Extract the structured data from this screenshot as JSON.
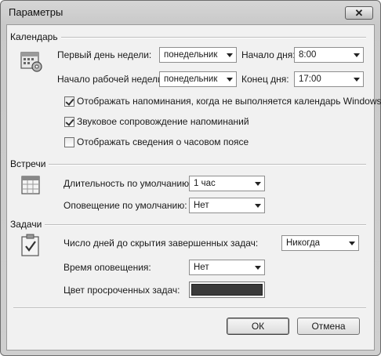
{
  "window": {
    "title": "Параметры",
    "close_icon": "close-icon"
  },
  "calendar": {
    "section_label": "Календарь",
    "first_day_label": "Первый день недели:",
    "first_day_value": "понедельник",
    "start_day_label": "Начало дня:",
    "start_day_value": "8:00",
    "workweek_start_label": "Начало рабочей недели:",
    "workweek_start_value": "понедельник",
    "end_day_label": "Конец дня:",
    "end_day_value": "17:00",
    "checkboxes": [
      {
        "label": "Отображать напоминания, когда не выполняется календарь Windows",
        "checked": true
      },
      {
        "label": "Звуковое сопровождение напоминаний",
        "checked": true
      },
      {
        "label": "Отображать сведения о часовом поясе",
        "checked": false
      }
    ]
  },
  "meetings": {
    "section_label": "Встречи",
    "duration_label": "Длительность по умолчанию:",
    "duration_value": "1 час",
    "reminder_label": "Оповещение по умолчанию:",
    "reminder_value": "Нет"
  },
  "tasks": {
    "section_label": "Задачи",
    "days_hide_label": "Число дней до скрытия завершенных задач:",
    "days_hide_value": "Никогда",
    "reminder_time_label": "Время оповещения:",
    "reminder_time_value": "Нет",
    "overdue_color_label": "Цвет просроченных задач:",
    "overdue_color": "#3a3a3a"
  },
  "buttons": {
    "ok": "ОК",
    "cancel": "Отмена"
  }
}
